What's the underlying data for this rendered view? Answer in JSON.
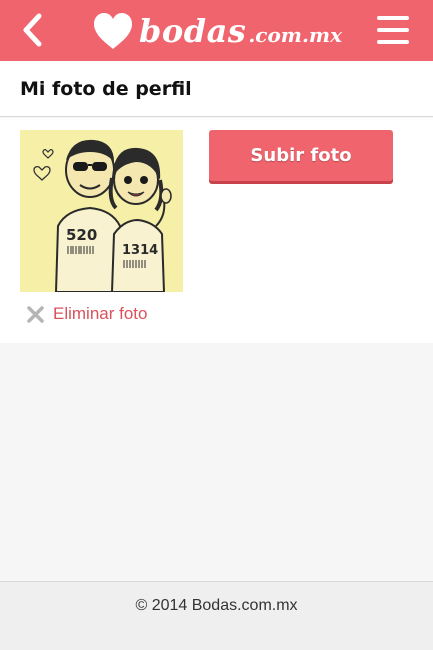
{
  "topbar": {
    "brand": "bodas",
    "brand_domain": ".com.mx",
    "back_icon": "chevron-left-icon",
    "menu_icon": "hamburger-menu-icon",
    "brand_icon": "heart-icon",
    "bg_color": "#f0646d"
  },
  "page": {
    "title": "Mi foto de perfil"
  },
  "profile_photo": {
    "shirt_left": "520",
    "shirt_right": "1314"
  },
  "actions": {
    "upload_label": "Subir foto",
    "delete_label": "Eliminar foto",
    "delete_icon": "close-x-icon",
    "accent_color": "#f0646d",
    "link_color": "#d9525c"
  },
  "footer": {
    "copyright": "© 2014 Bodas.com.mx"
  }
}
